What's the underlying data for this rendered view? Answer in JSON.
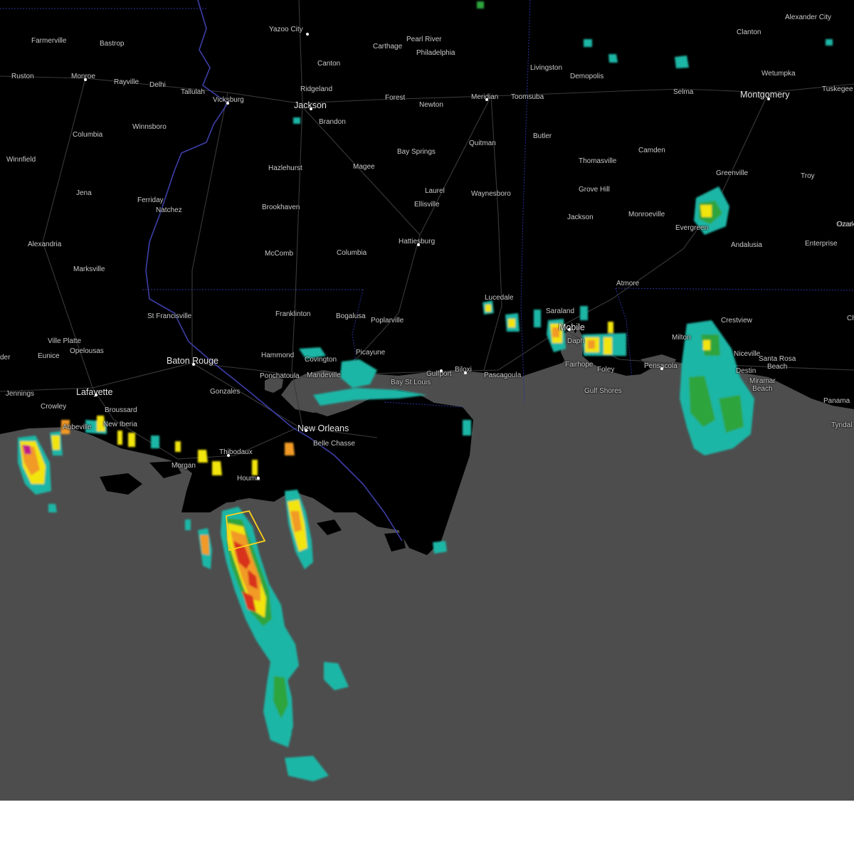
{
  "map": {
    "colors": {
      "land": "#000000",
      "water": "#4d4d4d",
      "road": "#3c3c3c",
      "state_border": "#2b2f9c",
      "river": "#3d3fa8",
      "city_label": "#c9c9c9",
      "warning_polygon": "#ffd21a",
      "radar_light": "#1fb6a6",
      "radar_green": "#2ea43d",
      "radar_yellow": "#f2e40c",
      "radar_orange": "#f19a25",
      "radar_red": "#d8301c",
      "radar_magenta": "#c0148c"
    },
    "cities": [
      {
        "id": "yazoo-city",
        "name": "Yazoo City",
        "major": false
      },
      {
        "id": "farmerville",
        "name": "Farmerville",
        "major": false
      },
      {
        "id": "bastrop",
        "name": "Bastrop",
        "major": false
      },
      {
        "id": "pearl-river",
        "name": "Pearl River",
        "major": false
      },
      {
        "id": "carthage",
        "name": "Carthage",
        "major": false
      },
      {
        "id": "philadelphia",
        "name": "Philadelphia",
        "major": false
      },
      {
        "id": "clanton",
        "name": "Clanton",
        "major": false
      },
      {
        "id": "alexander-city",
        "name": "Alexander City",
        "major": false
      },
      {
        "id": "canton",
        "name": "Canton",
        "major": false
      },
      {
        "id": "livingston",
        "name": "Livingston",
        "major": false
      },
      {
        "id": "demopolis",
        "name": "Demopolis",
        "major": false
      },
      {
        "id": "wetumpka",
        "name": "Wetumpka",
        "major": false
      },
      {
        "id": "ruston",
        "name": "Ruston",
        "major": false
      },
      {
        "id": "monroe",
        "name": "Monroe",
        "major": false
      },
      {
        "id": "rayville",
        "name": "Rayville",
        "major": false
      },
      {
        "id": "delhi",
        "name": "Delhi",
        "major": false
      },
      {
        "id": "ridgeland",
        "name": "Ridgeland",
        "major": false
      },
      {
        "id": "tallulah",
        "name": "Tallulah",
        "major": false
      },
      {
        "id": "tuskegee",
        "name": "Tuskegee",
        "major": false
      },
      {
        "id": "selma",
        "name": "Selma",
        "major": false
      },
      {
        "id": "montgomery",
        "name": "Montgomery",
        "major": true
      },
      {
        "id": "meridian",
        "name": "Meridian",
        "major": false
      },
      {
        "id": "toomsuba",
        "name": "Toomsuba",
        "major": false
      },
      {
        "id": "forest",
        "name": "Forest",
        "major": false
      },
      {
        "id": "vicksburg",
        "name": "Vicksburg",
        "major": false
      },
      {
        "id": "jackson",
        "name": "Jackson",
        "major": true
      },
      {
        "id": "newton",
        "name": "Newton",
        "major": false
      },
      {
        "id": "brandon",
        "name": "Brandon",
        "major": false
      },
      {
        "id": "winnsboro",
        "name": "Winnsboro",
        "major": false
      },
      {
        "id": "columbia-la",
        "name": "Columbia",
        "major": false
      },
      {
        "id": "butler",
        "name": "Butler",
        "major": false
      },
      {
        "id": "quitman",
        "name": "Quitman",
        "major": false
      },
      {
        "id": "camden",
        "name": "Camden",
        "major": false
      },
      {
        "id": "thomasville",
        "name": "Thomasville",
        "major": false
      },
      {
        "id": "winnfield",
        "name": "Winnfield",
        "major": false
      },
      {
        "id": "bay-springs",
        "name": "Bay Springs",
        "major": false
      },
      {
        "id": "hazlehurst",
        "name": "Hazlehurst",
        "major": false
      },
      {
        "id": "magee",
        "name": "Magee",
        "major": false
      },
      {
        "id": "greenville",
        "name": "Greenville",
        "major": false
      },
      {
        "id": "troy",
        "name": "Troy",
        "major": false
      },
      {
        "id": "grove-hill",
        "name": "Grove Hill",
        "major": false
      },
      {
        "id": "laurel",
        "name": "Laurel",
        "major": false
      },
      {
        "id": "jena",
        "name": "Jena",
        "major": false
      },
      {
        "id": "waynesboro",
        "name": "Waynesboro",
        "major": false
      },
      {
        "id": "ferriday",
        "name": "Ferriday",
        "major": false
      },
      {
        "id": "ellisville",
        "name": "Ellisville",
        "major": false
      },
      {
        "id": "brookhaven",
        "name": "Brookhaven",
        "major": false
      },
      {
        "id": "natchez",
        "name": "Natchez",
        "major": false
      },
      {
        "id": "monroeville",
        "name": "Monroeville",
        "major": false
      },
      {
        "id": "jackson-al",
        "name": "Jackson",
        "major": false
      },
      {
        "id": "evergreen",
        "name": "Evergreen",
        "major": false
      },
      {
        "id": "ozark",
        "name": "Ozark",
        "major": false
      },
      {
        "id": "hattiesburg",
        "name": "Hattiesburg",
        "major": false
      },
      {
        "id": "alexandria",
        "name": "Alexandria",
        "major": false
      },
      {
        "id": "andalusia",
        "name": "Andalusia",
        "major": false
      },
      {
        "id": "enterprise",
        "name": "Enterprise",
        "major": false
      },
      {
        "id": "mccomb",
        "name": "McComb",
        "major": false
      },
      {
        "id": "columbia-ms",
        "name": "Columbia",
        "major": false
      },
      {
        "id": "marksville",
        "name": "Marksville",
        "major": false
      },
      {
        "id": "atmore",
        "name": "Atmore",
        "major": false
      },
      {
        "id": "lucedale",
        "name": "Lucedale",
        "major": false
      },
      {
        "id": "saraland",
        "name": "Saraland",
        "major": false
      },
      {
        "id": "franklinton",
        "name": "Franklinton",
        "major": false
      },
      {
        "id": "st-francisville",
        "name": "St Francisville",
        "major": false
      },
      {
        "id": "bogalusa",
        "name": "Bogalusa",
        "major": false
      },
      {
        "id": "crestview",
        "name": "Crestview",
        "major": false
      },
      {
        "id": "poplarville",
        "name": "Poplarville",
        "major": false
      },
      {
        "id": "mobile",
        "name": "Mobile",
        "major": true
      },
      {
        "id": "ville-platte",
        "name": "Ville Platte",
        "major": false
      },
      {
        "id": "milton",
        "name": "Milton",
        "major": false
      },
      {
        "id": "opelousas",
        "name": "Opelousas",
        "major": false
      },
      {
        "id": "eunice",
        "name": "Eunice",
        "major": false
      },
      {
        "id": "picayune",
        "name": "Picayune",
        "major": false
      },
      {
        "id": "hammond",
        "name": "Hammond",
        "major": false
      },
      {
        "id": "niceville",
        "name": "Niceville",
        "major": false
      },
      {
        "id": "baton-rouge",
        "name": "Baton Rouge",
        "major": true
      },
      {
        "id": "covington",
        "name": "Covington",
        "major": false
      },
      {
        "id": "fairhope",
        "name": "Fairhope",
        "major": false
      },
      {
        "id": "santa-rosa-beach",
        "name": "Santa Rosa\nBeach",
        "major": false
      },
      {
        "id": "pensacola",
        "name": "Pensacola",
        "major": false
      },
      {
        "id": "biloxi",
        "name": "Biloxi",
        "major": false
      },
      {
        "id": "foley",
        "name": "Foley",
        "major": false
      },
      {
        "id": "destin",
        "name": "Destin",
        "major": false
      },
      {
        "id": "gulfport",
        "name": "Gulfport",
        "major": false
      },
      {
        "id": "ponchatoula",
        "name": "Ponchatoula",
        "major": false
      },
      {
        "id": "mandeville",
        "name": "Mandeville",
        "major": false
      },
      {
        "id": "pascagoula",
        "name": "Pascagoula",
        "major": false
      },
      {
        "id": "miramar-beach",
        "name": "Miramar\nBeach",
        "major": false
      },
      {
        "id": "bay-st-louis",
        "name": "Bay St Louis",
        "major": false
      },
      {
        "id": "gulf-shores",
        "name": "Gulf Shores",
        "major": false
      },
      {
        "id": "gonzales",
        "name": "Gonzales",
        "major": false
      },
      {
        "id": "jennings",
        "name": "Jennings",
        "major": false
      },
      {
        "id": "lafayette",
        "name": "Lafayette",
        "major": true
      },
      {
        "id": "panama",
        "name": "Panama",
        "major": false
      },
      {
        "id": "crowley",
        "name": "Crowley",
        "major": false
      },
      {
        "id": "broussard",
        "name": "Broussard",
        "major": false
      },
      {
        "id": "tyndall",
        "name": "Tyndal",
        "major": false
      },
      {
        "id": "new-iberia",
        "name": "New Iberia",
        "major": false
      },
      {
        "id": "abbeville",
        "name": "Abbeville",
        "major": false
      },
      {
        "id": "new-orleans",
        "name": "New Orleans",
        "major": true
      },
      {
        "id": "belle-chasse",
        "name": "Belle Chasse",
        "major": false
      },
      {
        "id": "thibodaux",
        "name": "Thibodaux",
        "major": false
      },
      {
        "id": "morgan-city",
        "name": "Morgan",
        "major": false
      },
      {
        "id": "houma",
        "name": "Houma",
        "major": false
      },
      {
        "id": "daphne",
        "name": "Daph",
        "major": false
      },
      {
        "id": "der",
        "name": "der",
        "major": false
      },
      {
        "id": "ch",
        "name": "Ch",
        "major": false
      },
      {
        "id": "ozar",
        "name": "Ozar",
        "major": false
      }
    ]
  }
}
